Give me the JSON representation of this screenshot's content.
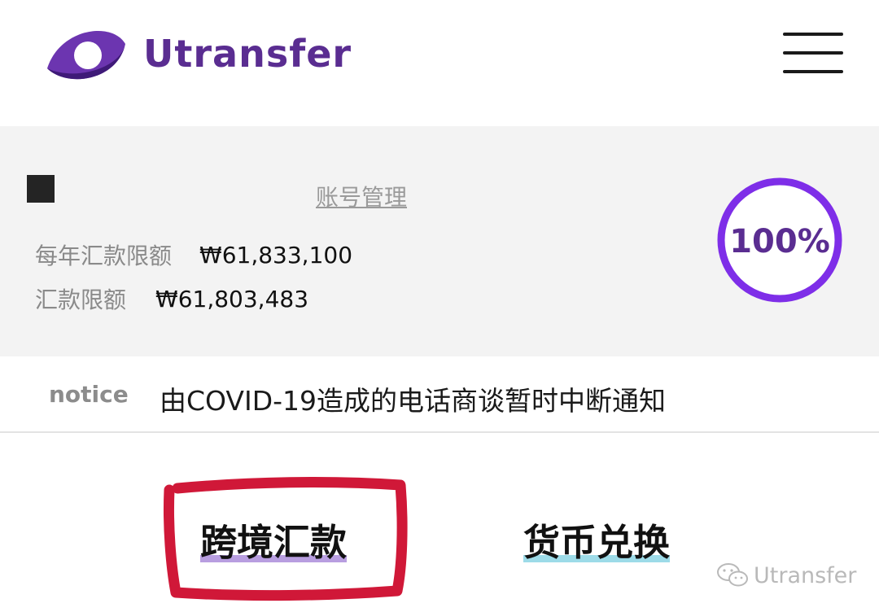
{
  "header": {
    "brand_name": "Utransfer",
    "brand_color": "#5a2d91",
    "logo_icon": "eye-logo-icon",
    "menu_icon": "hamburger-menu-icon"
  },
  "account": {
    "manage_link": "账号管理",
    "annual_limit_label": "每年汇款限额",
    "annual_limit_value": "₩61,833,100",
    "remit_limit_label": "汇款限额",
    "remit_limit_value": "₩61,803,483",
    "usage_percent_text": "100%",
    "usage_fraction": 1.0,
    "ring_color": "#7e2ee8"
  },
  "notice": {
    "label": "notice",
    "text": "由COVID-19造成的电话商谈暂时中断通知"
  },
  "tabs": [
    {
      "label": "跨境汇款",
      "highlight_color": "#b89ee0"
    },
    {
      "label": "货币兑换",
      "highlight_color": "#9ddbe8"
    }
  ],
  "annotation_color": "#d01838",
  "watermark": {
    "icon": "wechat-icon",
    "text": "Utransfer"
  }
}
